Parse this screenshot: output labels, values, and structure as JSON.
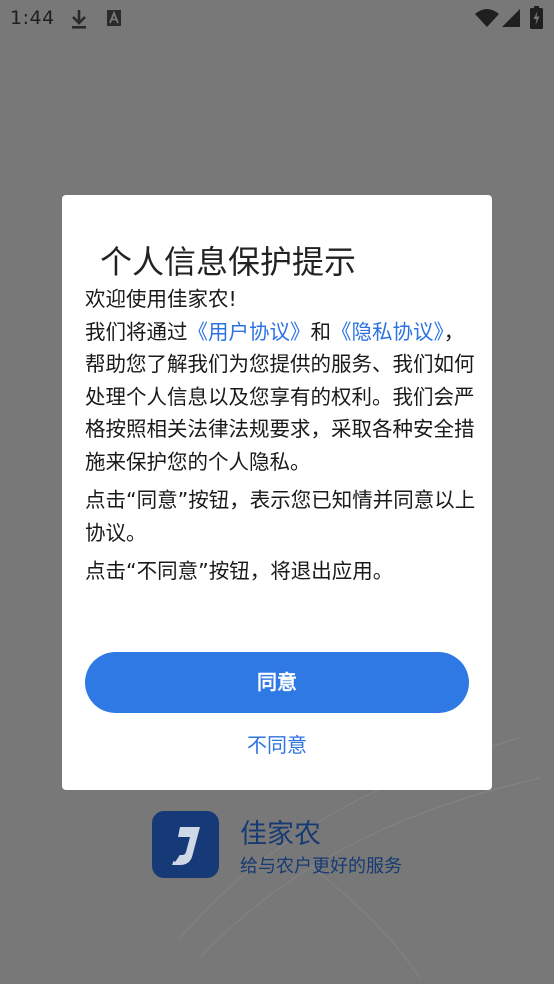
{
  "status_bar": {
    "time": "1:44",
    "icons": [
      "download-icon",
      "font-a-icon",
      "wifi-icon",
      "signal-icon",
      "battery-charging-icon"
    ]
  },
  "splash": {
    "app_name": "佳家农",
    "slogan": "给与农户更好的服务",
    "brand_color": "#153a77"
  },
  "dialog": {
    "title": "个人信息保护提示",
    "welcome": "欢迎使用佳家农!",
    "intro_before": "我们将通过",
    "user_agreement_link": "《用户协议》",
    "and": "和",
    "privacy_link": "《隐私协议》",
    "intro_after": "，帮助您了解我们为您提供的服务、我们如何处理个人信息以及您享有的权利。我们会严格按照相关法律法规要求，采取各种安全措施来保护您的个人隐私。",
    "agree_note": "点击“同意”按钮，表示您已知情并同意以上协议。",
    "disagree_note": "点击“不同意”按钮，将退出应用。",
    "agree_label": "同意",
    "disagree_label": "不同意",
    "accent_color": "#2f79e4"
  }
}
